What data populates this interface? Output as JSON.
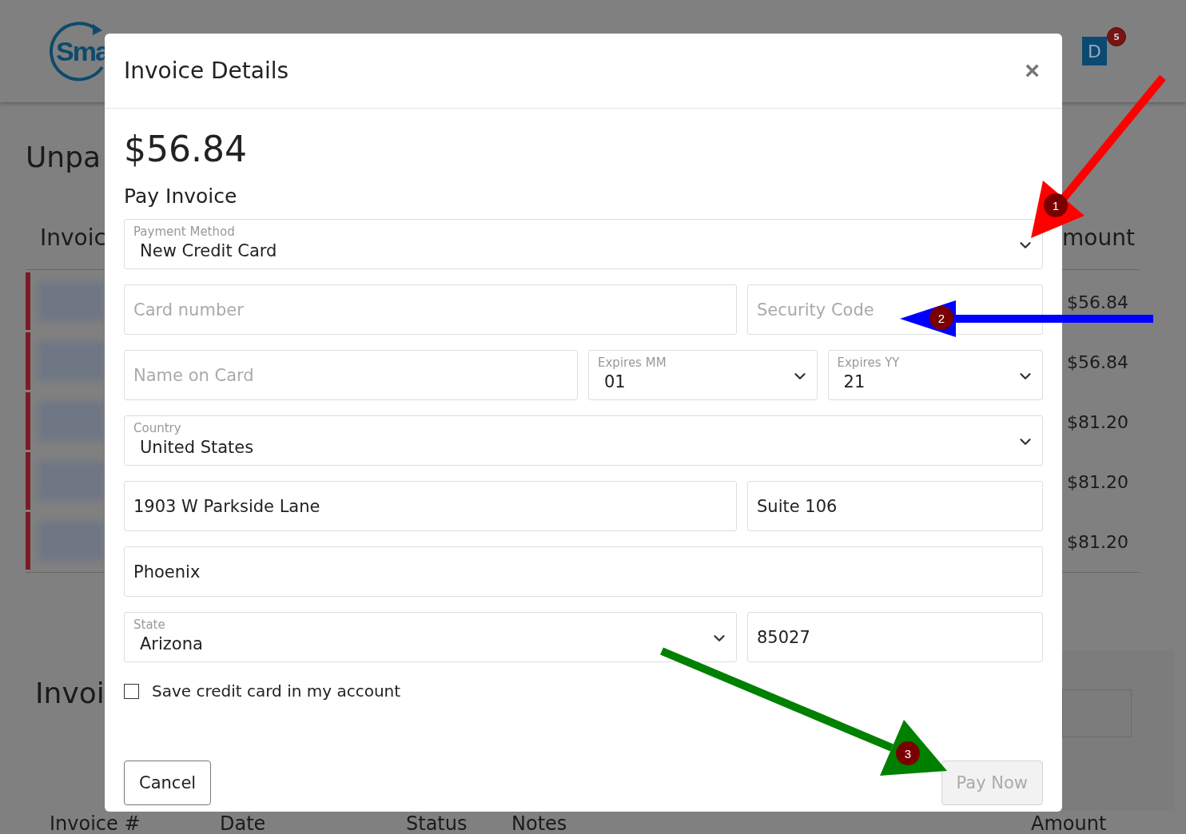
{
  "header": {
    "logo_text": "Sma",
    "avatar": "D",
    "notification_count": "5"
  },
  "page": {
    "heading": "Unpa",
    "column_header_left": "Invoic",
    "column_header_right": "mount",
    "rows": [
      {
        "amount": "$56.84"
      },
      {
        "amount": "$56.84"
      },
      {
        "amount": "$81.20"
      },
      {
        "amount": "$81.20"
      },
      {
        "amount": "$81.20"
      }
    ],
    "section_heading": "Invoi",
    "bottom_columns": [
      "Invoice #",
      "Date",
      "Status",
      "Notes",
      "Amount"
    ]
  },
  "modal": {
    "title": "Invoice Details",
    "close": "×",
    "amount": "$56.84",
    "subtitle": "Pay Invoice",
    "field_rows": [
      [
        {
          "kind": "select",
          "label": "Payment Method",
          "value": "New Credit Card"
        }
      ],
      [
        {
          "kind": "input",
          "placeholder": "Card number"
        },
        {
          "kind": "input",
          "placeholder": "Security Code"
        }
      ],
      [
        {
          "kind": "input",
          "placeholder": "Name on Card"
        },
        {
          "kind": "select",
          "label": "Expires MM",
          "value": "01"
        },
        {
          "kind": "select",
          "label": "Expires YY",
          "value": "21"
        }
      ],
      [
        {
          "kind": "select",
          "label": "Country",
          "value": "United States"
        }
      ],
      [
        {
          "kind": "input",
          "value": "1903 W Parkside Lane"
        },
        {
          "kind": "input",
          "value": "Suite 106"
        }
      ],
      [
        {
          "kind": "input",
          "value": "Phoenix"
        }
      ],
      [
        {
          "kind": "select",
          "label": "State",
          "value": "Arizona"
        },
        {
          "kind": "input",
          "value": "85027"
        }
      ]
    ],
    "save_card": {
      "label": "Save credit card in my account",
      "checked": false
    },
    "buttons": [
      {
        "label": "Cancel",
        "disabled": false
      },
      {
        "label": "Pay Now",
        "disabled": true
      }
    ]
  },
  "annotations": [
    {
      "label": "1",
      "color": "#ff0000"
    },
    {
      "label": "2",
      "color": "#0000ff"
    },
    {
      "label": "3",
      "color": "#008000"
    }
  ]
}
